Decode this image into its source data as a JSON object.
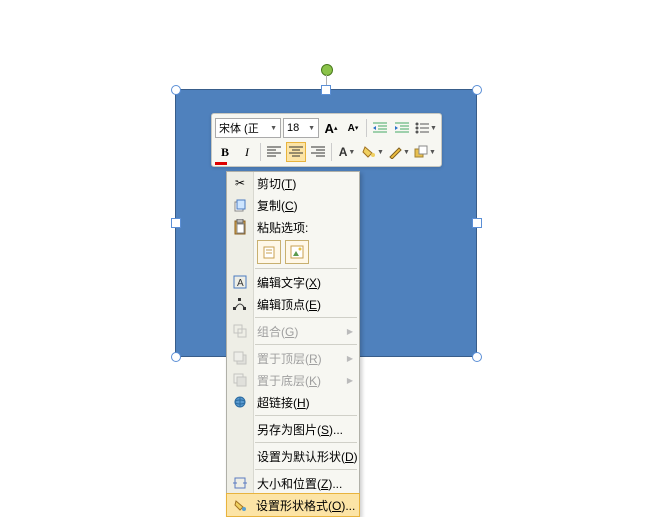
{
  "shape": {
    "fill": "#4f81bd"
  },
  "toolbar": {
    "font_name": "宋体 (正",
    "font_size": "18",
    "grow_font": "A",
    "shrink_font": "A",
    "bold": "B",
    "italic": "I"
  },
  "menu": {
    "cut": "剪切(T)",
    "copy": "复制(C)",
    "paste_header": "粘贴选项:",
    "edit_text": "编辑文字(X)",
    "edit_points": "编辑顶点(E)",
    "group": "组合(G)",
    "bring_front": "置于顶层(R)",
    "send_back": "置于底层(K)",
    "hyperlink": "超链接(H)",
    "save_pic": "另存为图片(S)...",
    "set_default": "设置为默认形状(D)",
    "size_pos": "大小和位置(Z)...",
    "format_shape": "设置形状格式(O)..."
  }
}
